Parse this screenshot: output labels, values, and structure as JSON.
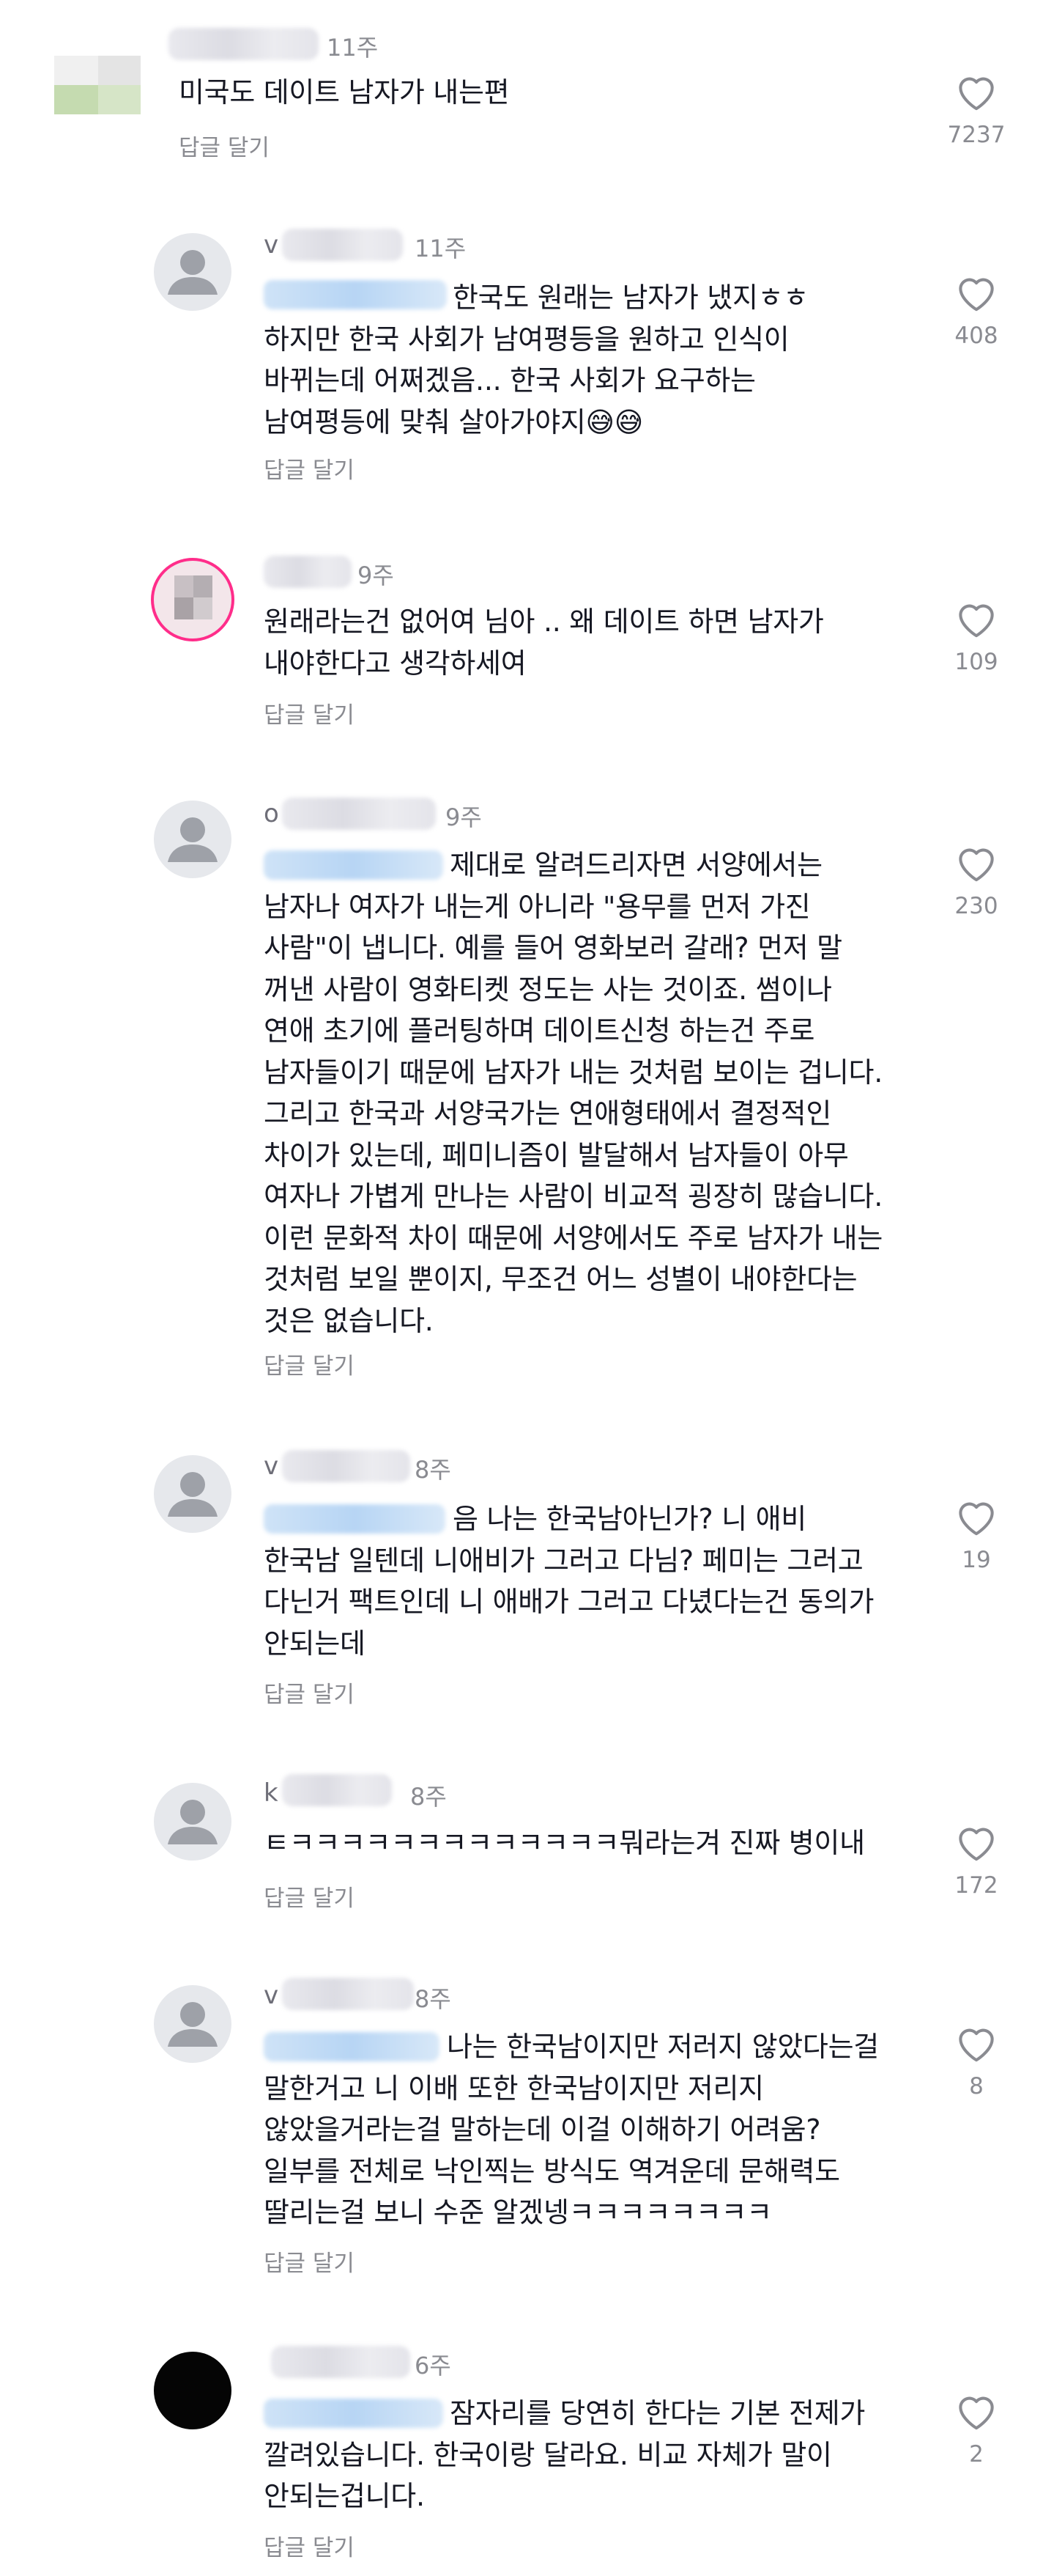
{
  "comments": [
    {
      "username": "",
      "time": "11주",
      "text": "미국도 데이트 남자가 내는편",
      "reply_label": "답글 달기",
      "likes": "7237"
    },
    {
      "username": "v",
      "time": "11주",
      "text": "한국도 원래는 남자가 냈지ㅎㅎ\n하지만 한국 사회가 남여평등을 원하고 인식이\n바뀌는데 어쩌겠음... 한국 사회가 요구하는\n남여평등에 맞춰 살아가야지😅😅",
      "reply_label": "답글 달기",
      "likes": "408"
    },
    {
      "username": "",
      "time": "9주",
      "text": "원래라는건 없어여 님아 .. 왜 데이트 하면 남자가\n내야한다고 생각하세여",
      "reply_label": "답글 달기",
      "likes": "109"
    },
    {
      "username": "o",
      "time": "9주",
      "text": "제대로 알려드리자면 서양에서는\n남자나 여자가 내는게 아니라 \"용무를 먼저 가진\n사람\"이 냅니다. 예를 들어 영화보러 갈래? 먼저 말\n꺼낸 사람이 영화티켓 정도는 사는 것이죠. 썸이나\n연애 초기에 플러팅하며 데이트신청 하는건 주로\n남자들이기 때문에 남자가 내는 것처럼 보이는 겁니다.\n그리고 한국과 서양국가는 연애형태에서 결정적인\n차이가 있는데, 페미니즘이 발달해서 남자들이 아무\n여자나 가볍게 만나는 사람이 비교적 굉장히 많습니다.\n이런 문화적 차이 때문에 서양에서도 주로 남자가 내는\n것처럼 보일 뿐이지, 무조건 어느 성별이 내야한다는\n것은 없습니다.",
      "reply_label": "답글 달기",
      "likes": "230"
    },
    {
      "username": "v",
      "time": "8주",
      "text": "음 나는 한국남아닌가? 니 애비\n한국남 일텐데 니애비가 그러고 다님? 페미는 그러고\n다닌거 팩트인데 니 애배가 그러고 다녔다는건 동의가\n안되는데",
      "reply_label": "답글 달기",
      "likes": "19"
    },
    {
      "username": "k",
      "time": "8주",
      "text": "ㅌㅋㅋㅋㅋㅋㅋㅋㅋㅋㅋㅋㅋㅋ뭐라는겨 진짜 병이내",
      "reply_label": "답글 달기",
      "likes": "172"
    },
    {
      "username": "v",
      "time": "8주",
      "text": "나는 한국남이지만 저러지 않았다는걸\n말한거고 니 이배 또한 한국남이지만 저리지\n않았을거라는걸 말하는데 이걸 이해하기 어려움?\n일부를 전체로 낙인찍는 방식도 역겨운데 문해력도\n딸리는걸 보니 수준 알겠넹ㅋㅋㅋㅋㅋㅋㅋㅋ",
      "reply_label": "답글 달기",
      "likes": "8"
    },
    {
      "username": "",
      "time": "6주",
      "text": "잠자리를 당연히 한다는 기본 전제가\n깔려있습니다. 한국이랑 달라요. 비교 자체가 말이\n안되는겁니다.",
      "reply_label": "답글 달기",
      "likes": "2"
    }
  ],
  "icons": {
    "like": "heart-outline-icon",
    "avatar_default": "default-user-icon"
  },
  "colors": {
    "text": "#161823",
    "secondary": "#8a8b91",
    "heart_stroke": "#8a8b91",
    "story_ring": "#ff2d8a"
  }
}
